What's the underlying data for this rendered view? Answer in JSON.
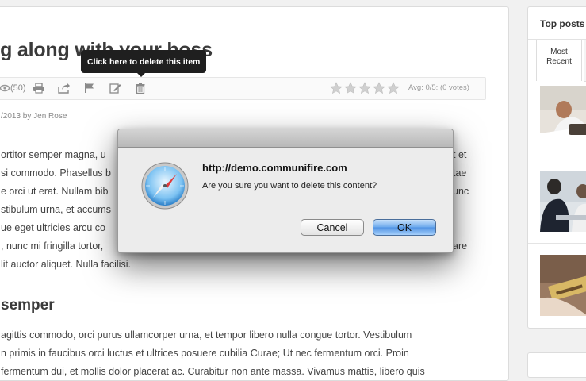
{
  "article": {
    "title": "ng along with your boss",
    "views": "(50)",
    "rating_text": "Avg: 0/5: (0 votes)",
    "rating_stars": 5,
    "byline": "/2013 by Jen Rose",
    "paragraph1": [
      "ortitor semper magna, u",
      "si commodo. Phasellus b",
      "e orci ut erat. Nullam bib",
      "stibulum urna, et accums",
      "ue eget ultricies arcu co",
      ", nunc mi fringilla tortor,",
      "lit auctor aliquet. Nulla facilisi."
    ],
    "paragraph1_right": [
      "t et",
      "tae",
      "unc",
      "",
      "",
      "are",
      ""
    ],
    "subheading": " semper",
    "paragraph2": [
      "agittis commodo, orci purus ullamcorper urna, et tempor libero nulla congue tortor. Vestibulum",
      "n primis in faucibus orci luctus et ultrices posuere cubilia Curae; Ut nec fermentum orci. Proin",
      "fermentum dui, et mollis dolor placerat ac. Curabitur non ante massa. Vivamus mattis, libero quis"
    ]
  },
  "tooltip": {
    "text": "Click here to delete this item"
  },
  "sidebar": {
    "title": "Top posts",
    "tab_active_line1": "Most",
    "tab_active_line2": "Recent"
  },
  "dialog": {
    "origin": "http://demo.communifire.com",
    "message": "Are you sure you want to delete this content?",
    "cancel_label": "Cancel",
    "ok_label": "OK",
    "icon": "safari-compass-icon"
  },
  "colors": {
    "ok_button": "#6aa8ec",
    "tooltip_bg": "#1f1f1f",
    "star": "#d0d0d0"
  }
}
